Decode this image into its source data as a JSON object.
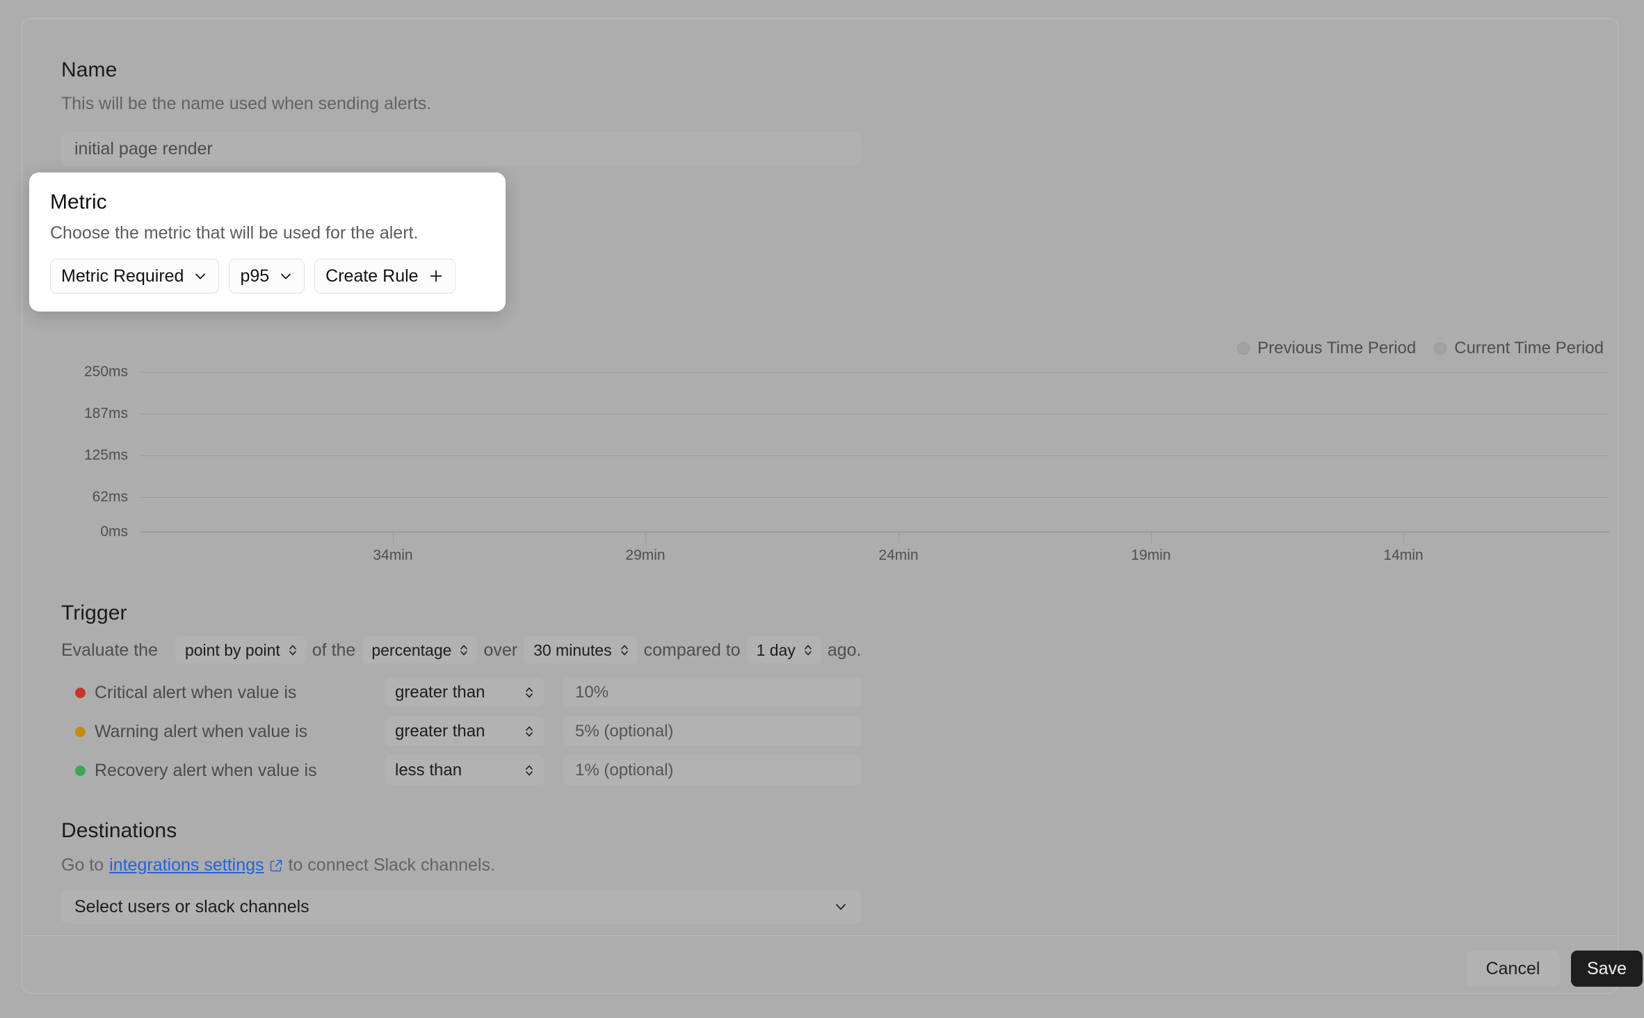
{
  "name_section": {
    "title": "Name",
    "description": "This will be the name used when sending alerts.",
    "input_value": "initial page render"
  },
  "metric_card": {
    "title": "Metric",
    "description": "Choose the metric that will be used for the alert.",
    "metric_select_label": "Metric Required",
    "aggregation_select_label": "p95",
    "create_rule_label": "Create Rule"
  },
  "chart_data": {
    "type": "line",
    "title": "",
    "xlabel": "",
    "ylabel": "",
    "x": [
      "34min",
      "29min",
      "24min",
      "19min",
      "14min"
    ],
    "ytick_labels": [
      "250ms",
      "187ms",
      "125ms",
      "62ms",
      "0ms"
    ],
    "ytick_values": [
      250,
      187,
      125,
      62,
      0
    ],
    "ylim": [
      0,
      250
    ],
    "grid": true,
    "legend_position": "top-right",
    "series": [
      {
        "name": "Previous Time Period",
        "color": "#a2a2a2",
        "values": []
      },
      {
        "name": "Current Time Period",
        "color": "#a2a2a2",
        "values": []
      }
    ]
  },
  "trigger": {
    "title": "Trigger",
    "prefix": "Evaluate the",
    "method": "point by point",
    "mid1": "of the",
    "unit": "percentage",
    "mid2": "over",
    "window": "30 minutes",
    "mid3": "compared to",
    "lookback": "1 day",
    "suffix": "ago.",
    "rows": [
      {
        "label": "Critical alert when value is",
        "dot_color": "#c0392b",
        "comparator": "greater than",
        "value": "10%"
      },
      {
        "label": "Warning alert when value is",
        "dot_color": "#c8890f",
        "comparator": "greater than",
        "value": "5% (optional)"
      },
      {
        "label": "Recovery alert when value is",
        "dot_color": "#3aa757",
        "comparator": "less than",
        "value": "1% (optional)"
      }
    ]
  },
  "destinations": {
    "title": "Destinations",
    "prefix": "Go to",
    "link_text": "integrations settings",
    "suffix": "to connect Slack channels.",
    "select_value": "Select users or slack channels"
  },
  "footer": {
    "cancel_label": "Cancel",
    "save_label": "Save"
  }
}
